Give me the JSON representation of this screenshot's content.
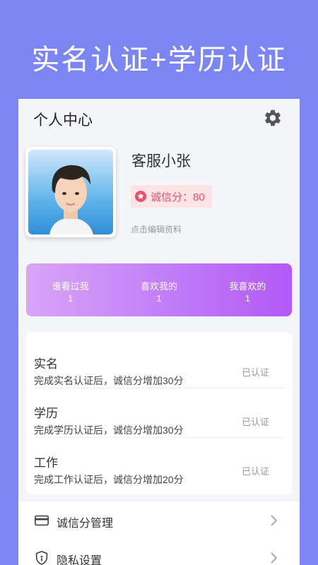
{
  "banner": {
    "title": "实名认证+学历认证"
  },
  "header": {
    "title": "个人中心",
    "settings_icon": "gear-icon"
  },
  "profile": {
    "nickname": "客服小张",
    "credit_label": "诚信分：80",
    "edit_link": "点击编辑资料"
  },
  "stats": [
    {
      "label": "谁看过我",
      "count": "1"
    },
    {
      "label": "喜欢我的",
      "count": "1"
    },
    {
      "label": "我喜欢的",
      "count": "1"
    }
  ],
  "verifications": [
    {
      "title": "实名",
      "desc": "完成实名认证后，诚信分增加30分",
      "status": "已认证"
    },
    {
      "title": "学历",
      "desc": "完成学历认证后，诚信分增加30分",
      "status": "已认证"
    },
    {
      "title": "工作",
      "desc": "完成工作认证后，诚信分增加20分",
      "status": "已认证"
    }
  ],
  "menu": [
    {
      "label": "诚信分管理",
      "icon": "credit-card-icon"
    },
    {
      "label": "隐私设置",
      "icon": "shield-icon"
    }
  ],
  "colors": {
    "background": "#7b86f4",
    "stats_gradient_start": "#d8a5f7",
    "stats_gradient_end": "#b359f6",
    "credit_accent": "#e8506a"
  }
}
